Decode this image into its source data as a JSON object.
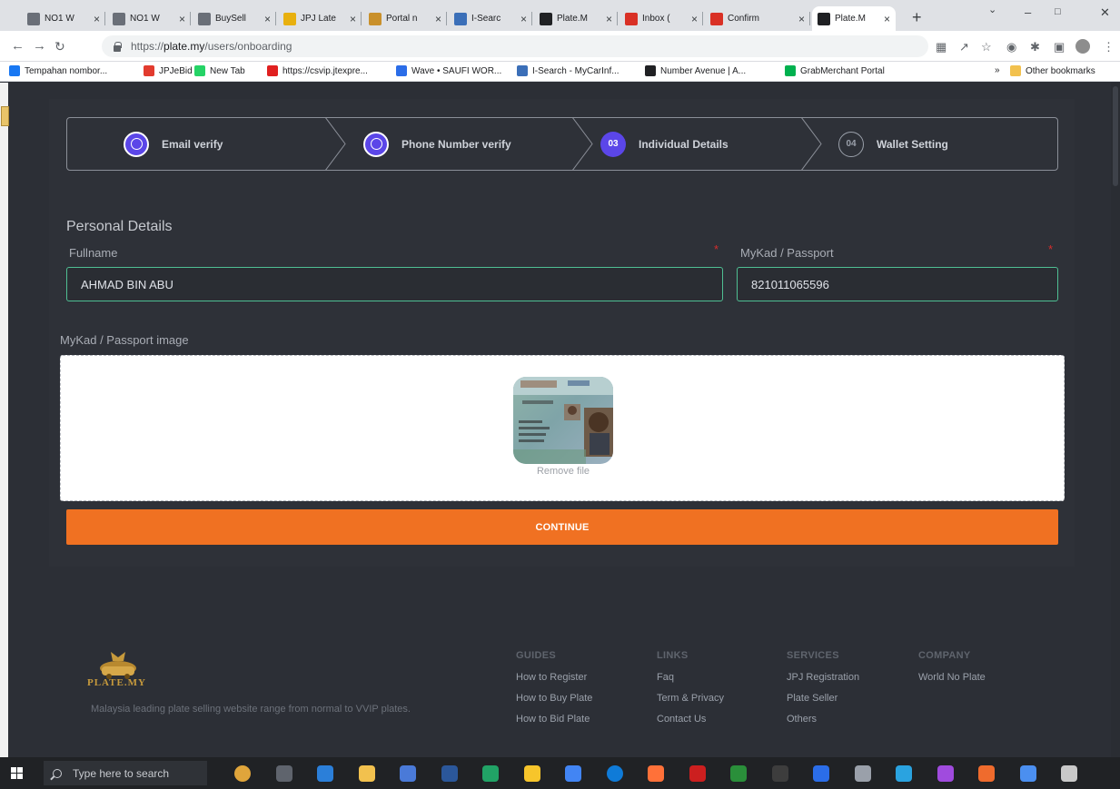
{
  "browser": {
    "tabs": [
      {
        "label": "NO1 W",
        "color": "#6a6f78"
      },
      {
        "label": "NO1 W",
        "color": "#6a6f78"
      },
      {
        "label": "BuySell",
        "color": "#6a6f78"
      },
      {
        "label": "JPJ Late",
        "color": "#e8b00f"
      },
      {
        "label": "Portal n",
        "color": "#c9902b"
      },
      {
        "label": "I-Searc",
        "color": "#3b6fb8"
      },
      {
        "label": "Plate.M",
        "color": "#202124"
      },
      {
        "label": "Inbox (",
        "color": "#d93025"
      },
      {
        "label": "Confirm",
        "color": "#d93025"
      },
      {
        "label": "Plate.M",
        "color": "#202124"
      }
    ],
    "url_scheme": "https://",
    "url_host": "plate.my",
    "url_path": "/users/onboarding",
    "bookmarks": [
      {
        "label": "Tempahan nombor...",
        "color": "#1877f2"
      },
      {
        "label": "JPJeBid",
        "color": "#e23b2e"
      },
      {
        "label": "New Tab",
        "color": "#25d366"
      },
      {
        "label": "https://csvip.jtexpre...",
        "color": "#e02020"
      },
      {
        "label": "Wave • SAUFI WOR...",
        "color": "#2b6de8"
      },
      {
        "label": "I-Search - MyCarInf...",
        "color": "#3b6fb8"
      },
      {
        "label": "Number Avenue | A...",
        "color": "#202124"
      },
      {
        "label": "GrabMerchant Portal",
        "color": "#00b14f"
      }
    ],
    "bookmarks_more": "»",
    "other_bookmarks": "Other bookmarks"
  },
  "stepper": {
    "steps": [
      {
        "number": "",
        "label": "Email verify",
        "state": "done"
      },
      {
        "number": "",
        "label": "Phone Number verify",
        "state": "done"
      },
      {
        "number": "03",
        "label": "Individual Details",
        "state": "current"
      },
      {
        "number": "04",
        "label": "Wallet Setting",
        "state": "pending"
      }
    ]
  },
  "form": {
    "section_title": "Personal Details",
    "fullname_label": "Fullname",
    "fullname_value": "AHMAD BIN ABU",
    "passport_label": "MyKad / Passport",
    "passport_value": "821011065596",
    "required_mark": "*",
    "image_label": "MyKad / Passport image",
    "remove_file": "Remove file",
    "continue_label": "CONTINUE"
  },
  "footer": {
    "logo_text": "PLATE.MY",
    "tagline": "Malaysia leading plate selling website range from normal to VVIP plates.",
    "columns": [
      {
        "heading": "GUIDES",
        "links": [
          "How to Register",
          "How to Buy Plate",
          "How to Bid Plate"
        ]
      },
      {
        "heading": "LINKS",
        "links": [
          "Faq",
          "Term & Privacy",
          "Contact Us"
        ]
      },
      {
        "heading": "SERVICES",
        "links": [
          "JPJ Registration",
          "Plate Seller",
          "Others"
        ]
      },
      {
        "heading": "COMPANY",
        "links": [
          "World No Plate"
        ]
      }
    ]
  },
  "taskbar": {
    "search_placeholder": "Type here to search",
    "apps": [
      "#e0a53b",
      "#5f646d",
      "#2b7fd9",
      "#f2c14e",
      "#4a7ad8",
      "#2b579a",
      "#21a366",
      "#f7c52b",
      "#4285f4",
      "#0f7bd8",
      "#ff7139",
      "#cc1f1f",
      "#2a8f3a",
      "#3d3d3d",
      "#2b6de8",
      "#9aa0aa",
      "#2aa3e0",
      "#a04bde",
      "#ef6b2d",
      "#4b8ff0",
      "#c9c9c9"
    ]
  },
  "colors": {
    "accent_purple": "#5b46e8",
    "continue_orange": "#f07122",
    "input_border_green": "#4fbf93",
    "page_bg": "#2c2f36"
  }
}
